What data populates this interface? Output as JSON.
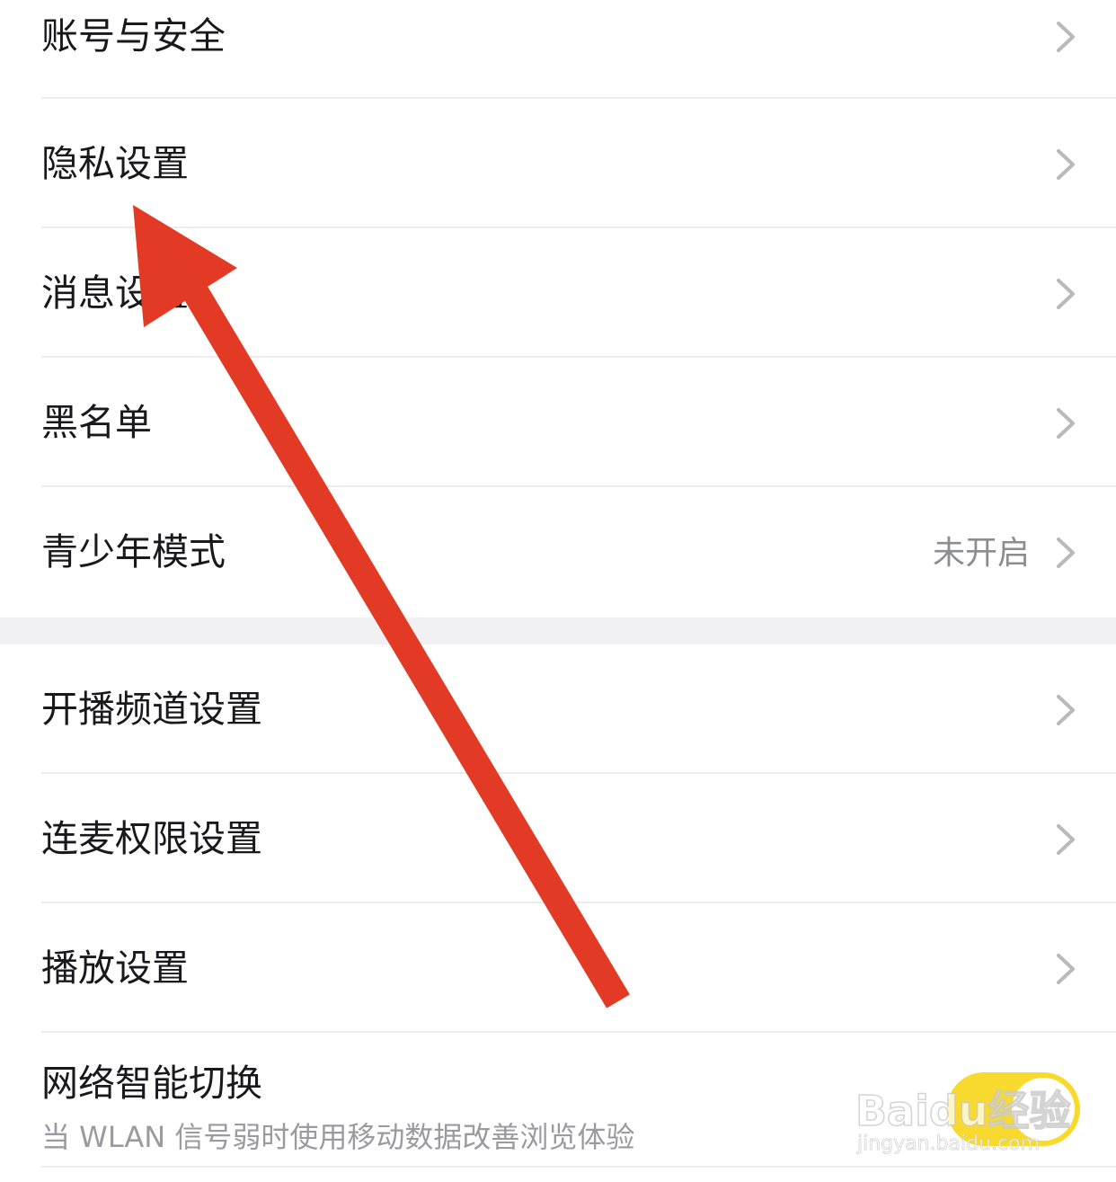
{
  "colors": {
    "background": "#ffffff",
    "group_gap": "#f1f1f4",
    "label": "#19191d",
    "secondary_text": "#8c8c93",
    "chevron": "#b8b8bd",
    "divider": "#ececef",
    "toggle_on": "#f8da2e",
    "annotation_arrow": "#e23a24"
  },
  "settings_group_1": {
    "items": [
      {
        "label": "账号与安全",
        "icon": "chevron-right-icon"
      },
      {
        "label": "隐私设置",
        "icon": "chevron-right-icon"
      },
      {
        "label": "消息设置",
        "icon": "chevron-right-icon"
      },
      {
        "label": "黑名单",
        "icon": "chevron-right-icon"
      },
      {
        "label": "青少年模式",
        "value": "未开启",
        "icon": "chevron-right-icon"
      }
    ]
  },
  "settings_group_2": {
    "items": [
      {
        "label": "开播频道设置",
        "icon": "chevron-right-icon"
      },
      {
        "label": "连麦权限设置",
        "icon": "chevron-right-icon"
      },
      {
        "label": "播放设置",
        "icon": "chevron-right-icon"
      }
    ],
    "toggle_item": {
      "label": "网络智能切换",
      "description": "当 WLAN 信号弱时使用移动数据改善浏览体验",
      "enabled": true
    }
  },
  "watermark": {
    "brand": "Baidu经验",
    "url": "jingyan.baidu.com"
  }
}
